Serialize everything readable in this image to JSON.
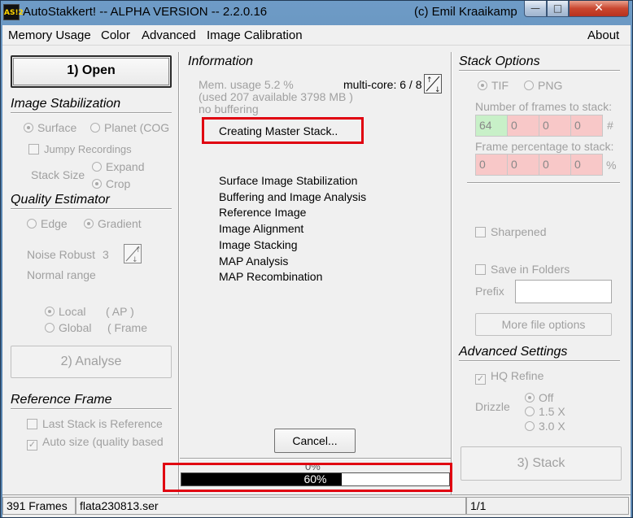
{
  "window": {
    "icon_text": "AS!2",
    "title": "AutoStakkert! -- ALPHA VERSION -- 2.2.0.16",
    "copyright": "(c) Emil Kraaikamp",
    "close_glyph": "✕",
    "max_glyph": "□",
    "min_glyph": "—"
  },
  "menu": {
    "items": [
      "Memory Usage",
      "Color",
      "Advanced",
      "Image Calibration"
    ],
    "about": "About"
  },
  "left": {
    "open_button": "1) Open",
    "stabilization_heading": "Image Stabilization",
    "stab_surface": "Surface",
    "stab_planet": "Planet (COG",
    "jumpy": "Jumpy Recordings",
    "stack_size_label": "Stack Size",
    "expand": "Expand",
    "crop": "Crop",
    "quality_heading": "Quality Estimator",
    "edge": "Edge",
    "gradient": "Gradient",
    "noise_robust_label": "Noise Robust",
    "noise_robust_value": "3",
    "normal_range": "Normal range",
    "local": "Local",
    "local_paren": "( AP )",
    "global": "Global",
    "global_paren": "( Frame",
    "analyse_button": "2) Analyse",
    "reference_heading": "Reference Frame",
    "last_stack": "Last Stack is Reference",
    "auto_size": "Auto size (quality based"
  },
  "center": {
    "info_heading": "Information",
    "mem_usage": "Mem. usage 5.2 %",
    "used_available": "(used 207 available 3798 MB )",
    "buffering": "no buffering",
    "multicore": "multi-core: 6 / 8",
    "current_step": "Creating Master Stack..",
    "steps": [
      "Surface Image Stabilization",
      "Buffering and Image Analysis",
      "Reference Image",
      "Image Alignment",
      "Image Stacking",
      "MAP Analysis",
      "MAP Recombination"
    ],
    "cancel_button": "Cancel...",
    "progress_top_label": "0%",
    "progress_value": 0.6,
    "progress_label": "60%"
  },
  "right": {
    "stack_heading": "Stack Options",
    "tif": "TIF",
    "png": "PNG",
    "frames_label": "Number of frames to stack:",
    "frames_values": [
      "64",
      "0",
      "0",
      "0"
    ],
    "frames_unit": "#",
    "pct_label": "Frame percentage to stack:",
    "pct_values": [
      "0",
      "0",
      "0",
      "0"
    ],
    "pct_unit": "%",
    "sharpened": "Sharpened",
    "save_in_folders": "Save in Folders",
    "prefix_label": "Prefix",
    "prefix_value": "",
    "more_file_options": "More file options",
    "advanced_heading": "Advanced Settings",
    "hq_refine": "HQ Refine",
    "drizzle_label": "Drizzle",
    "drizzle_off": "Off",
    "drizzle_15": "1.5 X",
    "drizzle_30": "3.0 X",
    "stack_button": "3) Stack"
  },
  "status": {
    "frames": "391 Frames",
    "file": "flata230813.ser",
    "page": "1/1"
  }
}
